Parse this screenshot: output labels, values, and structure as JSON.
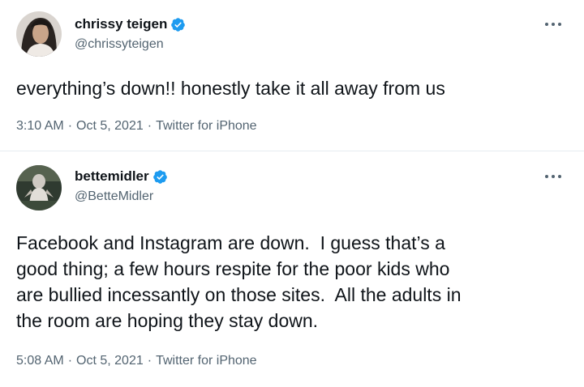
{
  "tweets": [
    {
      "display_name": "chrissy teigen",
      "handle": "@chrissyteigen",
      "verified": true,
      "text": "everything’s down!! honestly take it all away from us",
      "time": "3:10 AM",
      "date": "Oct 5, 2021",
      "source": "Twitter for iPhone",
      "separator": "·"
    },
    {
      "display_name": "bettemidler",
      "handle": "@BetteMidler",
      "verified": true,
      "text": "Facebook and Instagram are down.  I guess that’s a\ngood thing; a few hours respite for the poor kids who\nare bullied incessantly on those sites.  All the adults in\nthe room are hoping they stay down.",
      "time": "5:08 AM",
      "date": "Oct 5, 2021",
      "source": "Twitter for iPhone",
      "separator": "·"
    }
  ],
  "icons": {
    "verified": "verified-badge-icon",
    "more": "more-options-icon"
  },
  "colors": {
    "verified_blue": "#1d9bf0",
    "text": "#0f1419",
    "secondary": "#536471",
    "divider": "#e6ecf0"
  }
}
